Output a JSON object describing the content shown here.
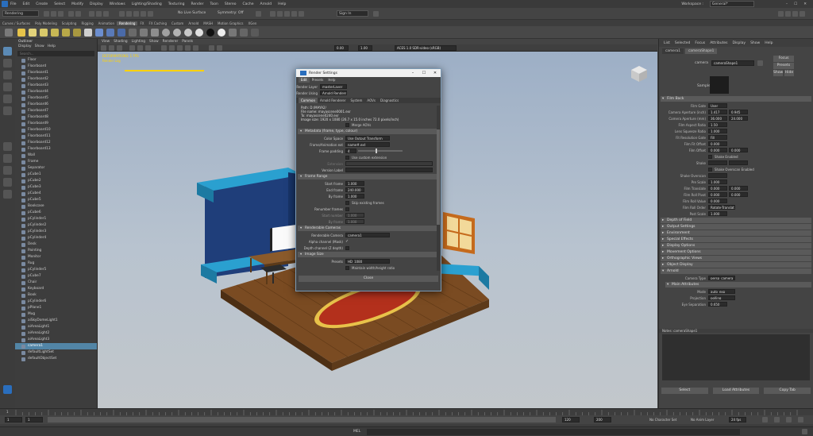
{
  "menubar": {
    "items": [
      "File",
      "Edit",
      "Create",
      "Select",
      "Modify",
      "Display",
      "Windows",
      "Lighting/Shading",
      "Texturing",
      "Render",
      "Toon",
      "Stereo",
      "Cache",
      "Arnold",
      "Help"
    ],
    "workspace_label": "Workspace :",
    "workspace_value": "General*"
  },
  "statusline": {
    "mode": "Rendering",
    "no_live_surface": "No Live Surface",
    "symmetry": "Symmetry: Off",
    "sign_in": "Sign In"
  },
  "shelf_tabs": [
    "Curves / Surfaces",
    "Poly Modeling",
    "Sculpting",
    "Rigging",
    "Animation",
    "Rendering",
    "FX",
    "FX Caching",
    "Custom",
    "Arnold",
    "MASH",
    "Motion Graphics",
    "XGen"
  ],
  "shelf_active_index": 5,
  "outliner": {
    "title": "Outliner",
    "menu": [
      "Display",
      "Show",
      "Help"
    ],
    "search_placeholder": "Search...",
    "items": [
      {
        "name": "Floor"
      },
      {
        "name": "Floorboard"
      },
      {
        "name": "Floorboard1"
      },
      {
        "name": "Floorboard2"
      },
      {
        "name": "Floorboard3"
      },
      {
        "name": "Floorboard4"
      },
      {
        "name": "Floorboard5"
      },
      {
        "name": "Floorboard6"
      },
      {
        "name": "Floorboard7"
      },
      {
        "name": "Floorboard8"
      },
      {
        "name": "Floorboard9"
      },
      {
        "name": "Floorboard10"
      },
      {
        "name": "Floorboard11"
      },
      {
        "name": "Floorboard12"
      },
      {
        "name": "Floorboard13"
      },
      {
        "name": "Wall"
      },
      {
        "name": "Frame"
      },
      {
        "name": "Separator"
      },
      {
        "name": "pCube1"
      },
      {
        "name": "pCube2"
      },
      {
        "name": "pCube3"
      },
      {
        "name": "pCube4"
      },
      {
        "name": "pCube5"
      },
      {
        "name": "Bookcase"
      },
      {
        "name": "pCube6"
      },
      {
        "name": "pCylinder1"
      },
      {
        "name": "pCylinder2"
      },
      {
        "name": "pCylinder3"
      },
      {
        "name": "pCylinder4"
      },
      {
        "name": "Desk"
      },
      {
        "name": "Painting"
      },
      {
        "name": "Monitor"
      },
      {
        "name": "Rug"
      },
      {
        "name": "pCylinder5"
      },
      {
        "name": "pCube7"
      },
      {
        "name": "Chair"
      },
      {
        "name": "Keyboard"
      },
      {
        "name": "Book"
      },
      {
        "name": "pCylinder6"
      },
      {
        "name": "pPlane1"
      },
      {
        "name": "Mug"
      },
      {
        "name": "aiSkyDomeLight1"
      },
      {
        "name": "aiAreaLight1"
      },
      {
        "name": "aiAreaLight2"
      },
      {
        "name": "aiAreaLight3"
      },
      {
        "name": "camera1"
      },
      {
        "name": "defaultLightSet"
      },
      {
        "name": "defaultObjectSet"
      }
    ],
    "selected_index": 45
  },
  "viewport": {
    "menu": [
      "View",
      "Shading",
      "Lighting",
      "Show",
      "Renderer",
      "Panels"
    ],
    "exposure": "0.00",
    "gamma": "1.00",
    "colorspace": "ACES 1.0 SDR-video (sRGB)",
    "hud_line": "DEFORMATIONS: 1 FPS",
    "render_log": "Render Log"
  },
  "attribute_editor": {
    "menu": [
      "List",
      "Selected",
      "Focus",
      "Attributes",
      "Display",
      "Show",
      "Help"
    ],
    "tabs": [
      "camera1",
      "cameraShape1"
    ],
    "camera_label": "camera",
    "camera_value": "cameraShape1",
    "focus_label": "Focus",
    "presets_label": "Presets",
    "show_label": "Show",
    "hide_label": "Hide",
    "sample_label": "Sample",
    "film_back_title": "Film Back",
    "film_rows": [
      {
        "label": "Film Gate",
        "value": "User"
      },
      {
        "label": "Camera Aperture (inch)",
        "value": "1.417",
        "value2": "0.945"
      },
      {
        "label": "Camera Aperture (mm)",
        "value": "36.000",
        "value2": "24.000"
      },
      {
        "label": "Film Aspect Ratio",
        "value": "1.50"
      },
      {
        "label": "Lens Squeeze Ratio",
        "value": "1.000"
      },
      {
        "label": "Fit Resolution Gate",
        "value": "Fill"
      },
      {
        "label": "Film Fit Offset",
        "value": "0.000"
      },
      {
        "label": "Film Offset",
        "value": "0.000",
        "value2": "0.000"
      }
    ],
    "shake_enabled": "Shake Enabled",
    "shake": "Shake",
    "shake_overscan": "Shake Overscan",
    "shake_overscan_enabled": "Shake Overscan Enabled",
    "pre_rows": [
      {
        "label": "Pre Scale",
        "value": "1.000"
      },
      {
        "label": "Film Translate",
        "value": "0.000",
        "value2": "0.000"
      },
      {
        "label": "Film Roll Pivot",
        "value": "0.000",
        "value2": "0.000"
      },
      {
        "label": "Film Roll Value",
        "value": "0.000"
      },
      {
        "label": "Film Roll Order",
        "value": "Rotate-Translate"
      },
      {
        "label": "Post Scale",
        "value": "1.000"
      }
    ],
    "sections": [
      "Depth of Field",
      "Output Settings",
      "Environment",
      "Special Effects",
      "Display Options",
      "Movement Options",
      "Orthographic Views",
      "Object Display",
      "Arnold"
    ],
    "camera_type_label": "Camera Type",
    "camera_type_value": "persp_camera",
    "main_attributes": "Main Attributes",
    "mode_label": "Mode",
    "mode_value": "auto_exp",
    "projection_label": "Projection",
    "projection_value": "polling",
    "eye_sep_label": "Eye Separation",
    "eye_sep_value": "0.650",
    "notes": "Notes: cameraShape1",
    "btn_select": "Select",
    "btn_load": "Load Attributes",
    "btn_copy": "Copy Tab"
  },
  "render_settings": {
    "title": "Render Settings",
    "menu": [
      "Edit",
      "Presets",
      "Help"
    ],
    "render_layer_label": "Render Layer",
    "render_layer_value": "masterLayer",
    "render_using_label": "Render Using",
    "render_using_value": "Arnold Renderer",
    "tabs": [
      "Common",
      "Arnold Renderer",
      "System",
      "AOVs",
      "Diagnostics"
    ],
    "path_line": "Path: D:/MAYA2/",
    "file_name_line": "File name: mayascene0001.exr",
    "to_line": "To: mayascene0240.exr",
    "image_size_line": "Image size: 1920 x 1080 (26.7 x 15.0 inches 72.0 pixels/inch)",
    "merge_aovs": "Merge AOVs",
    "metadata_section": "Metadata (frame, type, colour)",
    "color_space_label": "Color Space",
    "color_space_value": "Use Output Transform",
    "frame_anim_label": "Frame/Animation ext",
    "frame_anim_value": "name#.ext",
    "frame_padding_label": "Frame padding",
    "frame_padding_value": "4",
    "custom_ext": "Use custom extension",
    "extension_label": "Extension",
    "version_label": "Version Label",
    "frame_range_section": "Frame Range",
    "start_label": "Start frame",
    "start_value": "1.000",
    "end_label": "End frame",
    "end_value": "240.000",
    "by_label": "By frame",
    "by_value": "1.000",
    "skip_existing": "Skip existing frames",
    "renumber_label": "Renumber frames",
    "start_number_label": "Start number",
    "start_number_value": "1.000",
    "by_frame2_label": "By frame",
    "by_frame2_value": "1.000",
    "renderable_cameras_section": "Renderable Cameras",
    "renderable_camera_label": "Renderable Camera",
    "renderable_camera_value": "camera1",
    "alpha_label": "Alpha channel (Mask)",
    "depth_label": "Depth channel (Z depth)",
    "image_size_section": "Image Size",
    "presets_label": "Presets",
    "presets_value": "HD_1080",
    "maintain_ratio": "Maintain width/height ratio",
    "close_label": "Close"
  },
  "timeline": {
    "start": "1",
    "end": "240",
    "range_start": "1",
    "range_end": "120",
    "anim_end": "200",
    "current": "1",
    "no_character": "No Character Set",
    "no_anim_layer": "No Anim Layer",
    "fps": "24 fps",
    "mel_label": "MEL"
  }
}
